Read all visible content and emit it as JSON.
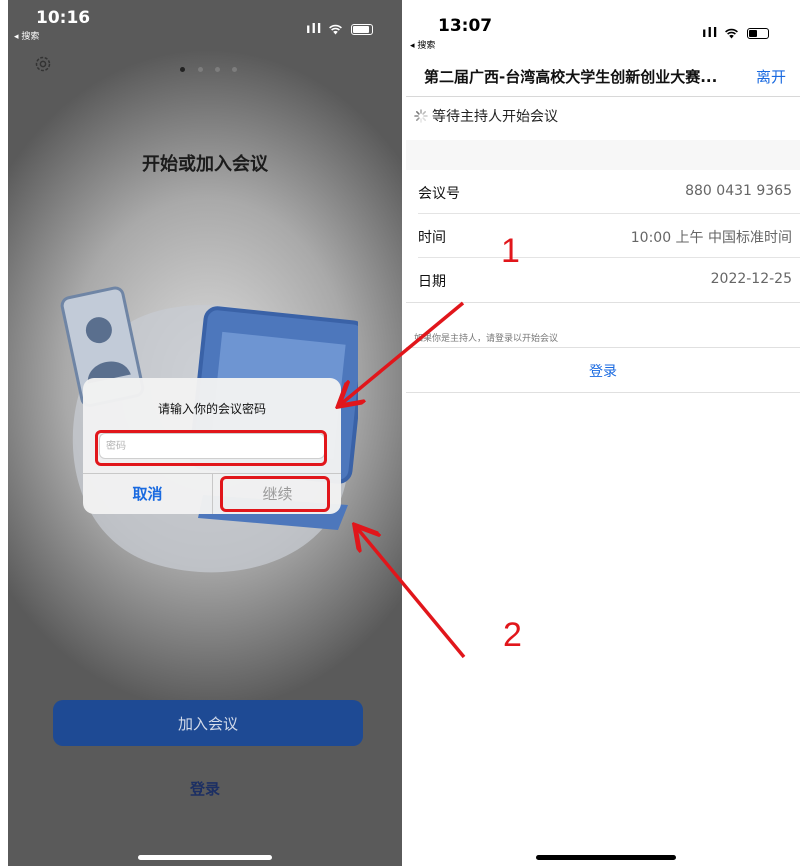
{
  "left_phone": {
    "status_bar": {
      "time": "10:16",
      "back_label": "◂ 搜索",
      "signal": "ıll"
    },
    "title": "开始或加入会议",
    "dialog": {
      "title": "请输入你的会议密码",
      "password_placeholder": "密码",
      "cancel_label": "取消",
      "continue_label": "继续"
    },
    "join_button_label": "加入会议",
    "login_label": "登录",
    "page_dots": 4,
    "active_dot": 0
  },
  "right_phone": {
    "status_bar": {
      "time": "13:07",
      "back_label": "◂ 搜索",
      "signal": "ıll"
    },
    "nav_title": "第二届广西-台湾高校大学生创新创业大赛...",
    "leave_label": "离开",
    "waiting_text": "等待主持人开始会议",
    "rows": [
      {
        "label": "会议号",
        "value": "880 0431 9365"
      },
      {
        "label": "时间",
        "value": "10:00 上午 中国标准时间"
      },
      {
        "label": "日期",
        "value": "2022-12-25"
      }
    ],
    "host_hint": "如果你是主持人，请登录以开始会议",
    "login_label": "登录"
  },
  "annotations": {
    "label_1": "1",
    "label_2": "2",
    "color": "#e1161b"
  },
  "colors": {
    "accent_blue": "#1a6ae0",
    "join_button": "#1e4a94",
    "annotation_red": "#e1161b"
  }
}
